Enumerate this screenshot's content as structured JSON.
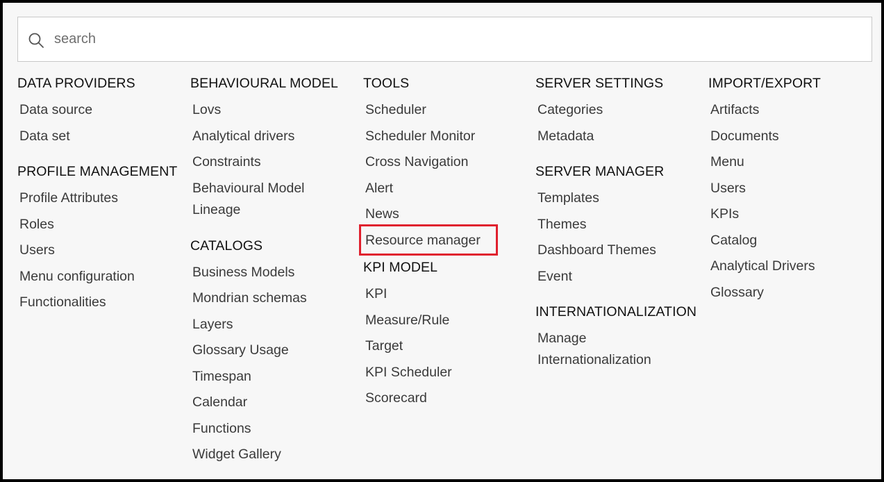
{
  "search": {
    "placeholder": "search",
    "value": "",
    "icon": "search-icon"
  },
  "highlight": {
    "color": "#e0202e",
    "target": "Resource manager"
  },
  "columns": [
    {
      "sections": [
        {
          "title": "DATA PROVIDERS",
          "items": [
            "Data source",
            "Data set"
          ]
        },
        {
          "title": "PROFILE MANAGEMENT",
          "items": [
            "Profile Attributes",
            "Roles",
            "Users",
            "Menu configuration",
            "Functionalities"
          ]
        }
      ]
    },
    {
      "sections": [
        {
          "title": "BEHAVIOURAL MODEL",
          "items": [
            "Lovs",
            "Analytical drivers",
            "Constraints",
            "Behavioural Model Lineage"
          ]
        },
        {
          "title": "CATALOGS",
          "items": [
            "Business Models",
            "Mondrian schemas",
            "Layers",
            "Glossary Usage",
            "Timespan",
            "Calendar",
            "Functions",
            "Widget Gallery"
          ]
        }
      ]
    },
    {
      "sections": [
        {
          "title": "TOOLS",
          "items": [
            "Scheduler",
            "Scheduler Monitor",
            "Cross Navigation",
            "Alert",
            "News",
            "Resource manager"
          ]
        },
        {
          "title": "KPI MODEL",
          "items": [
            "KPI",
            "Measure/Rule",
            "Target",
            "KPI Scheduler",
            "Scorecard"
          ]
        }
      ]
    },
    {
      "sections": [
        {
          "title": "SERVER SETTINGS",
          "items": [
            "Categories",
            "Metadata"
          ]
        },
        {
          "title": "SERVER MANAGER",
          "items": [
            "Templates",
            "Themes",
            "Dashboard Themes",
            "Event"
          ]
        },
        {
          "title": "INTERNATIONALIZATION",
          "items": [
            "Manage Internationalization"
          ]
        }
      ]
    },
    {
      "sections": [
        {
          "title": "IMPORT/EXPORT",
          "items": [
            "Artifacts",
            "Documents",
            "Menu",
            "Users",
            "KPIs",
            "Catalog",
            "Analytical Drivers",
            "Glossary"
          ]
        }
      ]
    }
  ]
}
